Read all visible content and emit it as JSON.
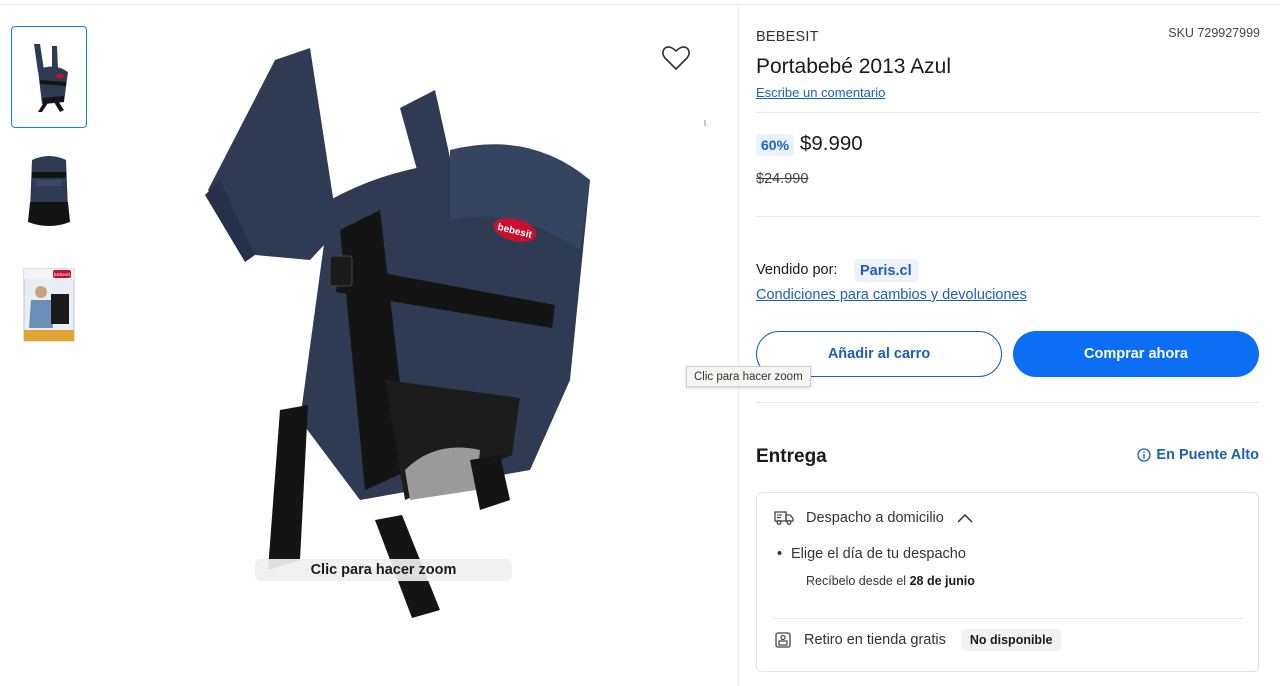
{
  "gallery": {
    "thumbnails": [
      {
        "name": "thumb-front",
        "active": true
      },
      {
        "name": "thumb-back",
        "active": false
      },
      {
        "name": "thumb-box",
        "active": false
      }
    ],
    "main_logo_text": "bebesit",
    "box_logo_text": "bebesit",
    "zoom_label": "Clic para hacer zoom",
    "tooltip": "Clic para hacer zoom"
  },
  "product": {
    "brand": "BEBESIT",
    "sku": "SKU 729927999",
    "title": "Portabebé 2013 Azul",
    "review_link": "Escribe un comentario",
    "discount": "60%",
    "price": "$9.990",
    "old_price": "$24.990"
  },
  "seller": {
    "label": "Vendido por:",
    "name": "Paris.cl",
    "conditions_link": "Condiciones para cambios y devoluciones"
  },
  "actions": {
    "add_to_cart": "Añadir al carro",
    "buy_now": "Comprar ahora"
  },
  "delivery": {
    "heading": "Entrega",
    "location": "En Puente Alto",
    "home_delivery": "Despacho a domicilio",
    "choose_day": "Elige el día de tu despacho",
    "receive_prefix": "Recíbelo desde el",
    "receive_date": "28 de junio",
    "pickup": "Retiro en tienda gratis",
    "pickup_status": "No disponible"
  },
  "colors": {
    "accent_blue": "#0c6ef5",
    "link_blue": "#1d5fb8",
    "carrier_navy": "#2e3b52",
    "strap_black": "#141414"
  },
  "icons": [
    "heart-icon",
    "info-icon",
    "truck-icon",
    "chevron-up-icon",
    "store-icon"
  ]
}
